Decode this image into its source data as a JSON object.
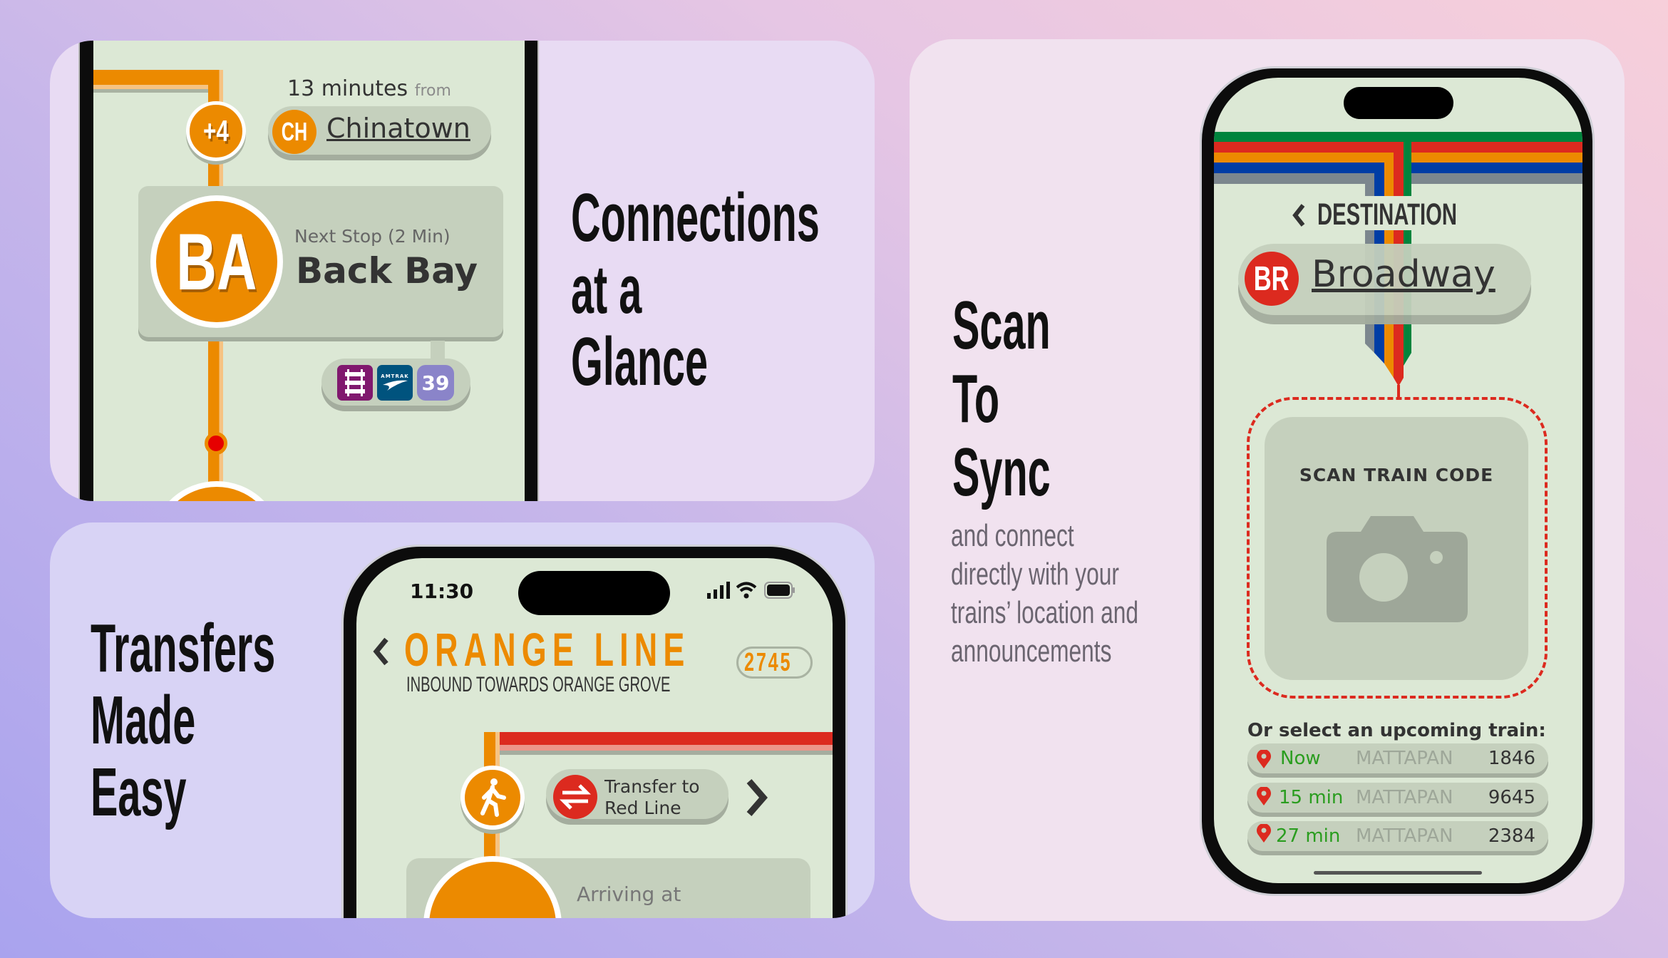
{
  "background": {
    "gradient_from": "#a9a3ee",
    "gradient_to": "#f7cfda"
  },
  "colors": {
    "screen": "#dce8d5",
    "card": "#c5d0bd",
    "orange_line": "#ec8a00",
    "red_line": "#dc2a1f",
    "green_line": "#00843d",
    "blue_line": "#003da5",
    "silver_line": "#7c878e",
    "status_green": "#2a9d1f"
  },
  "panels": {
    "connections": {
      "headline": [
        "Connections",
        "at a",
        "Glance"
      ],
      "eta_minutes": "13 minutes",
      "eta_from": "from",
      "skipped_stops_badge": "+4",
      "from_station": {
        "code": "CH",
        "name": "Chinatown"
      },
      "next_stop": {
        "code": "BA",
        "label": "Next Stop (2 Min)",
        "name": "Back Bay"
      },
      "connections": [
        {
          "icon": "commuter-rail-icon"
        },
        {
          "icon": "amtrak-icon",
          "text": "AMTRAK"
        },
        {
          "icon": "bus-icon",
          "text": "39"
        }
      ]
    },
    "transfers": {
      "headline": [
        "Transfers",
        "Made",
        "Easy"
      ],
      "status_time": "11:30",
      "line_title": "ORANGE LINE",
      "direction": "INBOUND TOWARDS ORANGE GROVE",
      "train_number": "2745",
      "transfer_label": [
        "Transfer to",
        "Red Line"
      ],
      "arriving_label": "Arriving at"
    },
    "sync": {
      "headline": [
        "Scan",
        "To",
        "Sync"
      ],
      "body": [
        "and connect",
        "directly with your",
        "trains’ location and",
        "announcements"
      ],
      "destination_label": "DESTINATION",
      "destination": {
        "code": "BR",
        "name": "Broadway"
      },
      "scan_label": "SCAN TRAIN CODE",
      "upcoming_label": "Or select an upcoming train:",
      "trains": [
        {
          "eta": "Now",
          "destination": "MATTAPAN",
          "number": "1846"
        },
        {
          "eta": "15 min",
          "destination": "MATTAPAN",
          "number": "9645"
        },
        {
          "eta": "27 min",
          "destination": "MATTAPAN",
          "number": "2384"
        }
      ]
    }
  }
}
